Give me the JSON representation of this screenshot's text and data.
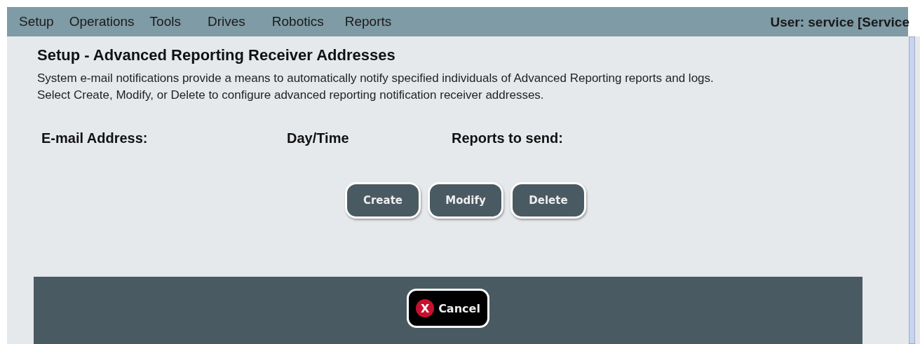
{
  "menu": [
    {
      "label": "Setup"
    },
    {
      "label": "Operations"
    },
    {
      "label": "Tools"
    },
    {
      "label": "Drives"
    },
    {
      "label": "Robotics"
    },
    {
      "label": "Reports"
    }
  ],
  "user": "User: service [Service",
  "title": "Setup - Advanced Reporting Receiver Addresses",
  "description": [
    "System e-mail notifications provide a means to automatically notify specified individuals of Advanced Reporting reports and logs.",
    "Select Create, Modify, or Delete to configure advanced reporting notification receiver addresses."
  ],
  "columns": [
    "E-mail Address:",
    "Day/Time",
    "Reports to send:"
  ],
  "buttons": [
    "Create",
    "Modify",
    "Delete"
  ],
  "cancel": {
    "label": "Cancel",
    "icon": "X"
  }
}
